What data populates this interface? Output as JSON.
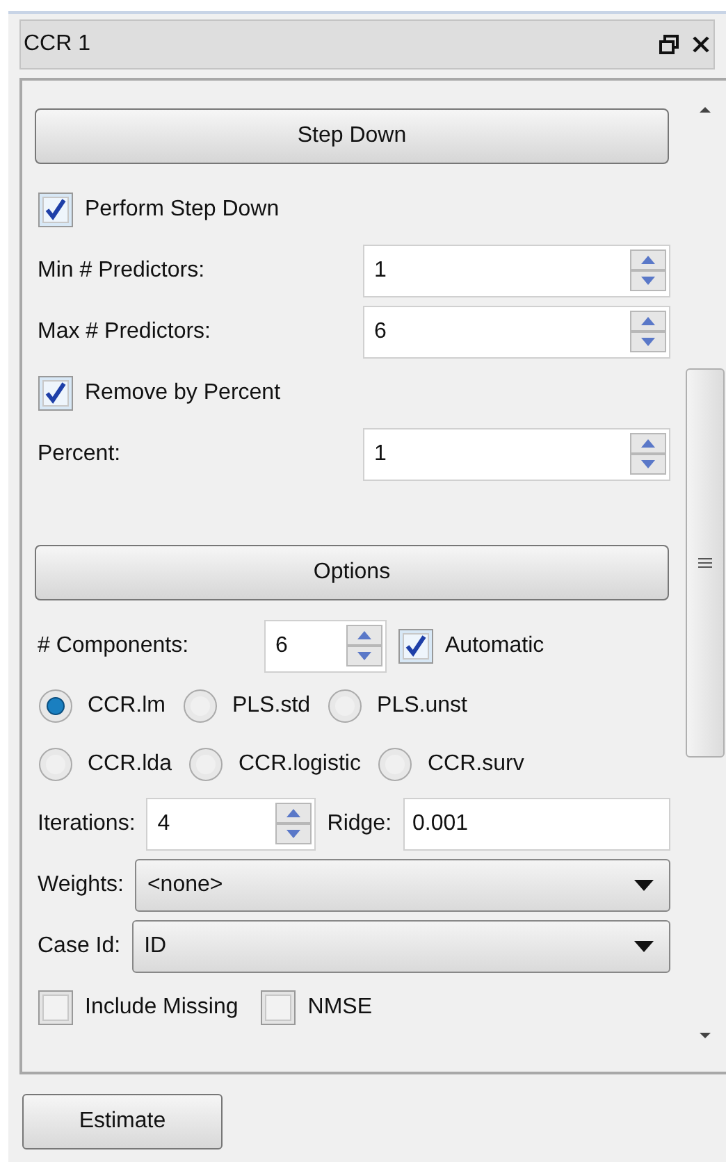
{
  "panel": {
    "title": "CCR 1"
  },
  "sections": [
    {
      "header": "Step Down",
      "rows": [
        {
          "kind": "check",
          "label": "Perform Step Down",
          "checked": true
        },
        {
          "kind": "spin_field",
          "label": "Min # Predictors:",
          "value": "1"
        },
        {
          "kind": "spin_field",
          "label": "Max # Predictors:",
          "value": "6"
        },
        {
          "kind": "check",
          "label": "Remove by Percent",
          "checked": true
        },
        {
          "kind": "spin_field",
          "label": "Percent:",
          "value": "1"
        }
      ]
    },
    {
      "header": "Options",
      "rows": [
        {
          "kind": "components",
          "label": "# Components:",
          "value": "6",
          "check_label": "Automatic",
          "checked": true
        },
        {
          "kind": "radios",
          "options": [
            {
              "label": "CCR.lm",
              "selected": true
            },
            {
              "label": "PLS.std",
              "selected": false
            },
            {
              "label": "PLS.unst",
              "selected": false
            }
          ]
        },
        {
          "kind": "radios",
          "options": [
            {
              "label": "CCR.lda",
              "selected": false
            },
            {
              "label": "CCR.logistic",
              "selected": false
            },
            {
              "label": "CCR.surv",
              "selected": false
            }
          ]
        },
        {
          "kind": "iter_ridge",
          "label": "Iterations:",
          "value": "4",
          "ridge_label": "Ridge:",
          "ridge_value": "0.001"
        },
        {
          "kind": "combo",
          "label": "Weights:",
          "value": "<none>"
        },
        {
          "kind": "combo",
          "label": "Case Id:",
          "value": "ID"
        },
        {
          "kind": "checks",
          "items": [
            {
              "label": "Include Missing",
              "checked": false
            },
            {
              "label": "NMSE",
              "checked": false
            }
          ]
        }
      ]
    }
  ],
  "estimate_button": "Estimate"
}
